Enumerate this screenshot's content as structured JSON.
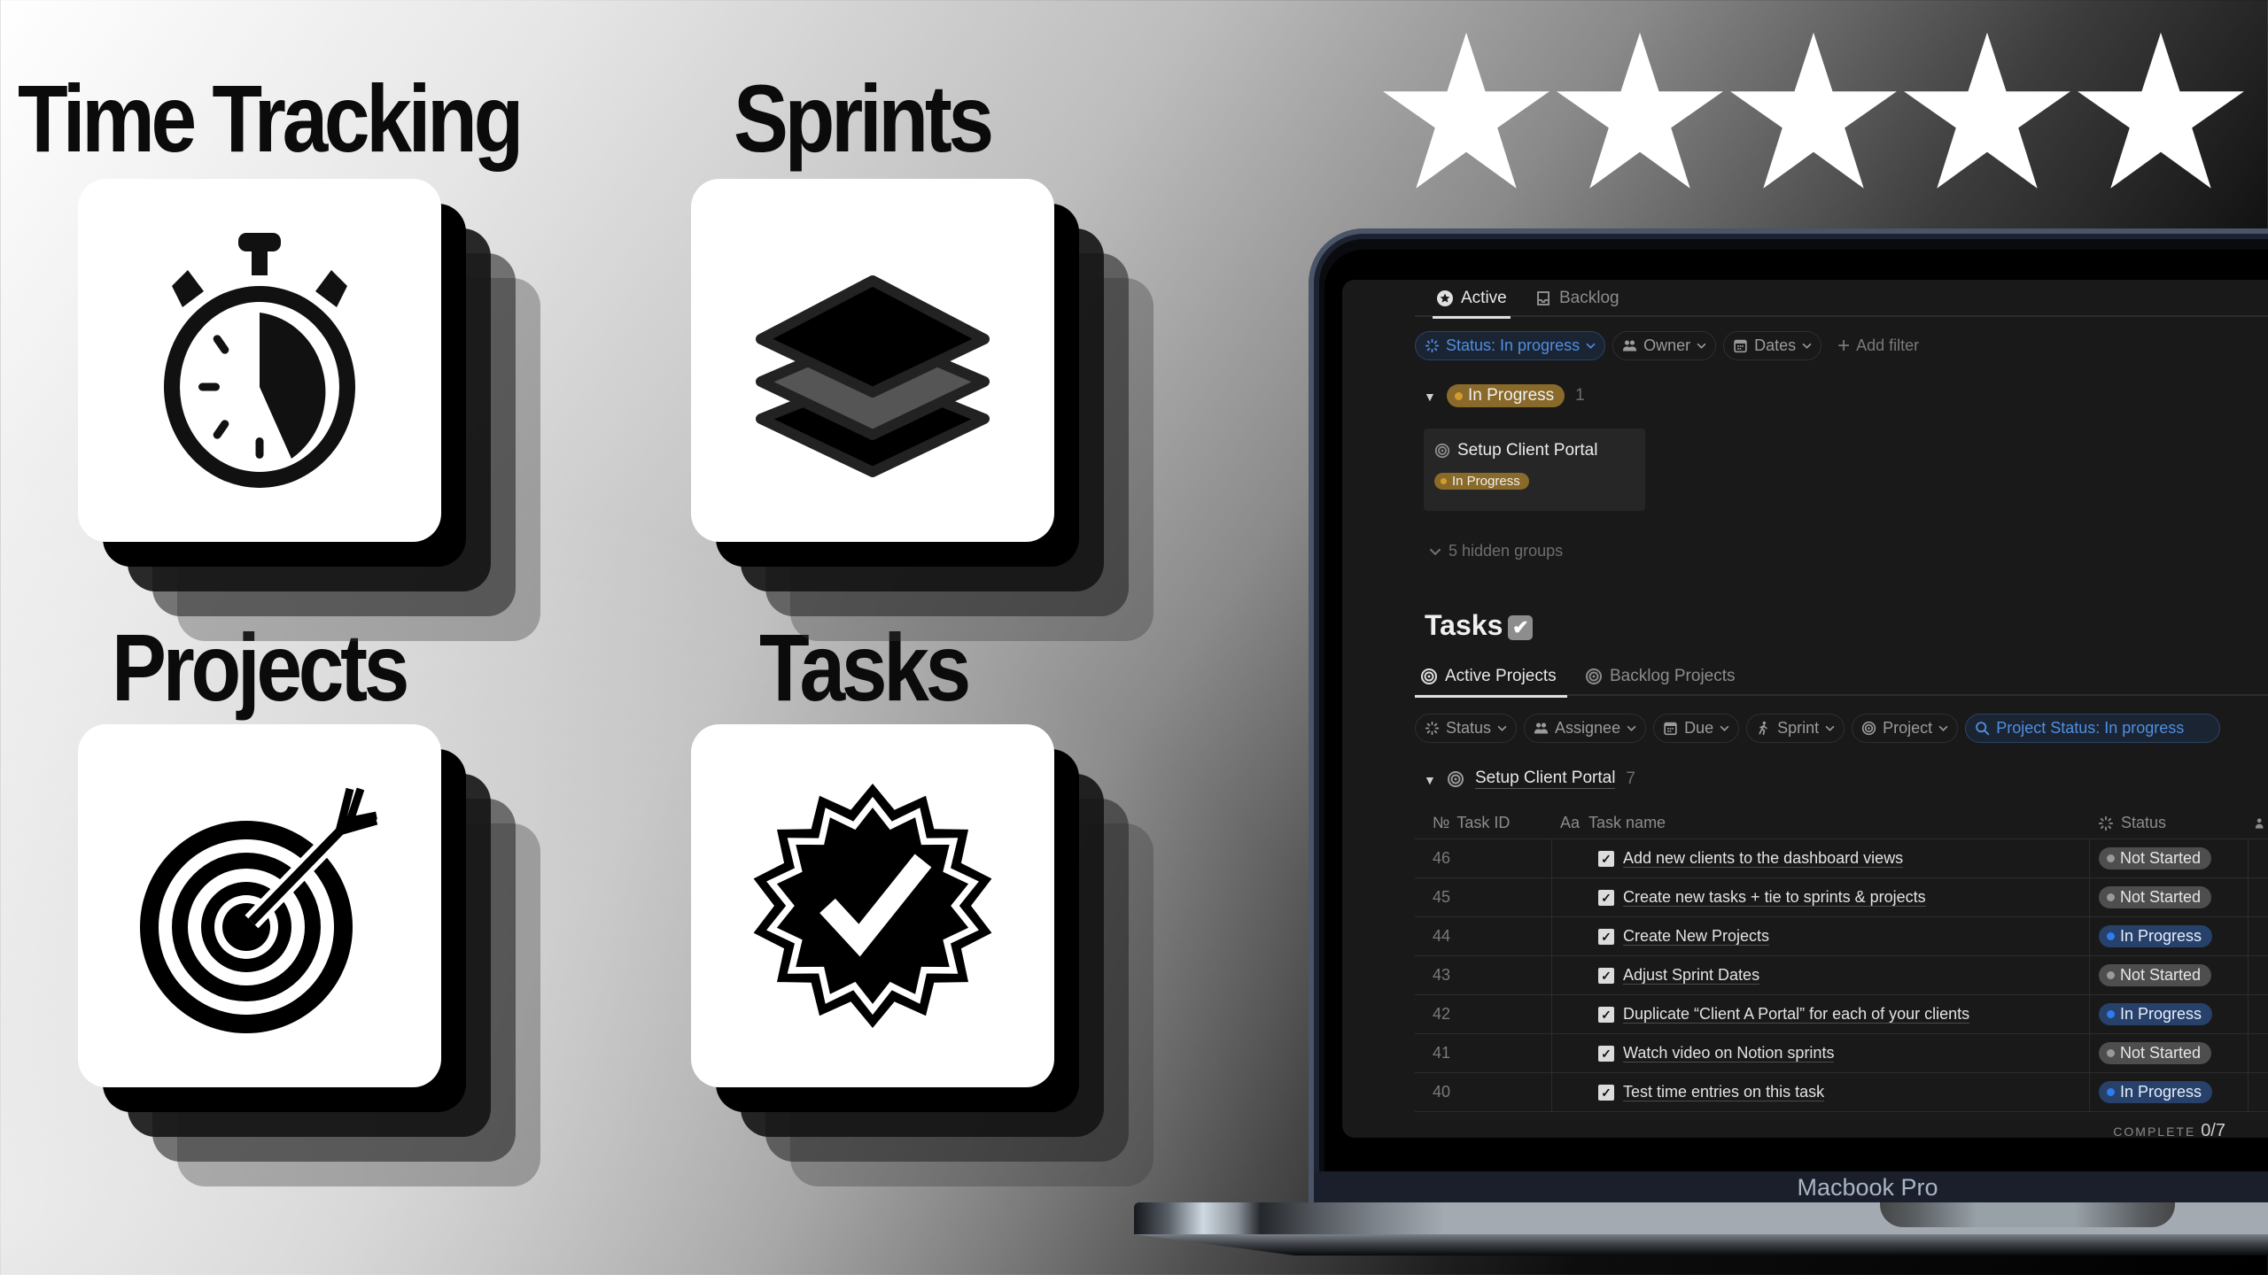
{
  "features": [
    {
      "title": "Time Tracking",
      "icon": "stopwatch-icon"
    },
    {
      "title": "Sprints",
      "icon": "layers-icon"
    },
    {
      "title": "Projects",
      "icon": "target-icon"
    },
    {
      "title": "Tasks",
      "icon": "verified-badge-icon"
    }
  ],
  "rating": {
    "stars": 5,
    "max": 5
  },
  "laptop": {
    "label": "Macbook Pro"
  },
  "app": {
    "sprints_view": {
      "tabs": [
        {
          "label": "Active",
          "icon": "star-circle-icon",
          "active": true
        },
        {
          "label": "Backlog",
          "icon": "inbox-icon",
          "active": false
        }
      ],
      "filters": [
        {
          "label": "Status: In progress",
          "icon": "status-icon",
          "active": true
        },
        {
          "label": "Owner",
          "icon": "people-icon",
          "active": false
        },
        {
          "label": "Dates",
          "icon": "calendar-icon",
          "active": false
        }
      ],
      "add_filter": "Add filter",
      "group": {
        "label": "In Progress",
        "count": "1"
      },
      "card": {
        "title": "Setup Client Portal",
        "status": "In Progress"
      },
      "hidden_groups": "5 hidden groups"
    },
    "tasks_view": {
      "title": "Tasks",
      "title_emoji": "✔",
      "tabs": [
        {
          "label": "Active Projects",
          "icon": "target-icon",
          "active": true
        },
        {
          "label": "Backlog Projects",
          "icon": "target-icon",
          "active": false
        }
      ],
      "filters": [
        {
          "label": "Status",
          "icon": "status-icon"
        },
        {
          "label": "Assignee",
          "icon": "people-icon"
        },
        {
          "label": "Due",
          "icon": "calendar-icon"
        },
        {
          "label": "Sprint",
          "icon": "running-icon"
        },
        {
          "label": "Project",
          "icon": "target-icon"
        }
      ],
      "search_filter": "Project Status: In progress",
      "group": {
        "label": "Setup Client Portal",
        "count": "7"
      },
      "columns": {
        "id": "Task ID",
        "id_prefix": "№",
        "name": "Task name",
        "name_prefix": "Aa",
        "status": "Status"
      },
      "rows": [
        {
          "id": "46",
          "name": "Add new clients to the dashboard views",
          "status": "Not Started"
        },
        {
          "id": "45",
          "name": "Create new tasks + tie to sprints & projects",
          "status": "Not Started"
        },
        {
          "id": "44",
          "name": "Create New Projects",
          "status": "In Progress"
        },
        {
          "id": "43",
          "name": "Adjust Sprint Dates",
          "status": "Not Started"
        },
        {
          "id": "42",
          "name": "Duplicate “Client A Portal” for each of your clients",
          "status": "In Progress"
        },
        {
          "id": "41",
          "name": "Watch video on Notion sprints",
          "status": "Not Started"
        },
        {
          "id": "40",
          "name": "Test time entries on this task",
          "status": "In Progress"
        }
      ],
      "footer": {
        "label": "COMPLETE",
        "value": "0/7"
      }
    },
    "colors": {
      "in_progress_gold": "#8a6a2a",
      "in_progress_blue": "#27416b",
      "not_started_grey": "#4e4e4e",
      "filter_blue": "#4f8fe0",
      "app_bg": "#191919"
    }
  }
}
